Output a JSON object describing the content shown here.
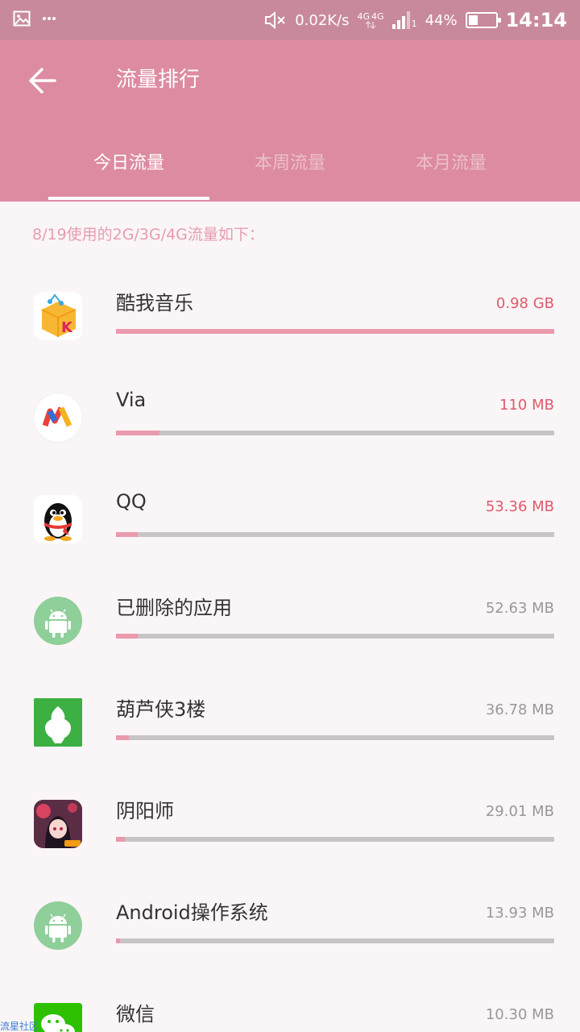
{
  "status_bar": {
    "speed": "0.02K/s",
    "network_a": "4G",
    "network_b": "4G",
    "sim_slot": "1",
    "battery": "44%",
    "battery_level": 0.44,
    "time": "14:14"
  },
  "toolbar": {
    "title": "流量排行",
    "tabs": [
      {
        "label": "今日流量"
      },
      {
        "label": "本周流量"
      },
      {
        "label": "本月流量"
      }
    ]
  },
  "subtitle": "8/19使用的2G/3G/4G流量如下：",
  "apps": [
    {
      "name": "酷我音乐",
      "usage": "0.98 GB",
      "fraction": 1.0,
      "highlight": true,
      "icon": "kuwo-music-icon"
    },
    {
      "name": "Via",
      "usage": "110 MB",
      "fraction": 0.1,
      "highlight": true,
      "icon": "via-browser-icon"
    },
    {
      "name": "QQ",
      "usage": "53.36 MB",
      "fraction": 0.05,
      "highlight": true,
      "icon": "qq-penguin-icon"
    },
    {
      "name": "已删除的应用",
      "usage": "52.63 MB",
      "fraction": 0.05,
      "highlight": false,
      "icon": "android-icon"
    },
    {
      "name": "葫芦侠3楼",
      "usage": "36.78 MB",
      "fraction": 0.03,
      "highlight": false,
      "icon": "huluxia-icon"
    },
    {
      "name": "阴阳师",
      "usage": "29.01 MB",
      "fraction": 0.02,
      "highlight": false,
      "icon": "onmyoji-icon"
    },
    {
      "name": "Android操作系统",
      "usage": "13.93 MB",
      "fraction": 0.01,
      "highlight": false,
      "icon": "android-icon"
    },
    {
      "name": "微信",
      "usage": "10.30 MB",
      "fraction": 0.01,
      "highlight": false,
      "icon": "wechat-icon"
    }
  ],
  "watermark": "流星社区",
  "colors": {
    "status_bar": "#c88a9b",
    "toolbar": "#dd8ba1",
    "bar_fill": "#e99aad",
    "bar_track": "#c8c3c5",
    "usage_hot": "#e05a6b"
  }
}
